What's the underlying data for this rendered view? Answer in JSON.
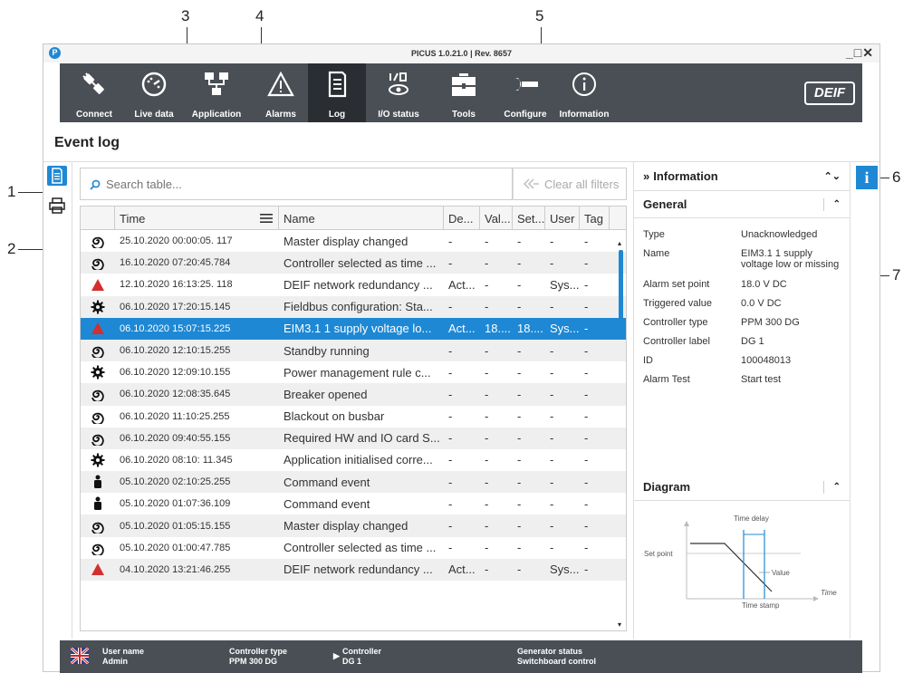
{
  "callouts": [
    "1",
    "2",
    "3",
    "4",
    "5",
    "6",
    "7"
  ],
  "window": {
    "title": "PICUS 1.0.21.0 | Rev. 8657",
    "controls": "_□✕",
    "logo": "P"
  },
  "toolbar": {
    "items": [
      {
        "label": "Connect",
        "icon": "plug-icon"
      },
      {
        "label": "Live data",
        "icon": "gauge-icon"
      },
      {
        "label": "Application",
        "icon": "diagram-icon"
      },
      {
        "label": "Alarms",
        "icon": "warning-icon"
      },
      {
        "label": "Log",
        "icon": "document-icon",
        "active": true
      },
      {
        "label": "I/O status",
        "icon": "io-icon"
      },
      {
        "label": "Tools",
        "icon": "toolbox-icon"
      },
      {
        "label": "Configure",
        "icon": "wrench-icon"
      },
      {
        "label": "Information",
        "icon": "info-icon"
      }
    ],
    "brand": "DEIF"
  },
  "page": {
    "title": "Event log"
  },
  "search": {
    "placeholder": "Search table...",
    "clear_label": "Clear all filters"
  },
  "table": {
    "headers": [
      "Time",
      "Name",
      "De...",
      "Val...",
      "Set...",
      "User",
      "Tag"
    ],
    "rows": [
      {
        "icon": "spiral",
        "time": "25.10.2020 00:00:05. 117",
        "name": "Master display changed",
        "de": "-",
        "val": "-",
        "set": "-",
        "user": "-",
        "tag": "-"
      },
      {
        "icon": "spiral",
        "time": "16.10.2020 07:20:45.784",
        "name": "Controller selected as time ...",
        "de": "-",
        "val": "-",
        "set": "-",
        "user": "-",
        "tag": "-"
      },
      {
        "icon": "alarm",
        "time": "12.10.2020 16:13:25. 118",
        "name": "DEIF network redundancy ...",
        "de": "Act...",
        "val": "-",
        "set": "-",
        "user": "Sys...",
        "tag": "-"
      },
      {
        "icon": "gear",
        "time": "06.10.2020 17:20:15.145",
        "name": "Fieldbus configuration: Sta...",
        "de": "-",
        "val": "-",
        "set": "-",
        "user": "-",
        "tag": "-"
      },
      {
        "icon": "alarm",
        "time": "06.10.2020 15:07:15.225",
        "name": "EIM3.1 1 supply voltage lo...",
        "de": "Act...",
        "val": "18....",
        "set": "18....",
        "user": "Sys...",
        "tag": "-",
        "selected": true
      },
      {
        "icon": "spiral",
        "time": "06.10.2020 12:10:15.255",
        "name": "Standby running",
        "de": "-",
        "val": "-",
        "set": "-",
        "user": "-",
        "tag": "-"
      },
      {
        "icon": "gear",
        "time": "06.10.2020 12:09:10.155",
        "name": "Power management rule c...",
        "de": "-",
        "val": "-",
        "set": "-",
        "user": "-",
        "tag": "-"
      },
      {
        "icon": "spiral",
        "time": "06.10.2020 12:08:35.645",
        "name": "Breaker opened",
        "de": "-",
        "val": "-",
        "set": "-",
        "user": "-",
        "tag": "-"
      },
      {
        "icon": "spiral",
        "time": "06.10.2020  11:10:25.255",
        "name": "Blackout on busbar",
        "de": "-",
        "val": "-",
        "set": "-",
        "user": "-",
        "tag": "-"
      },
      {
        "icon": "spiral",
        "time": "06.10.2020 09:40:55.155",
        "name": "Required HW and IO card S...",
        "de": "-",
        "val": "-",
        "set": "-",
        "user": "-",
        "tag": "-"
      },
      {
        "icon": "gear",
        "time": "06.10.2020 08:10: 11.345",
        "name": "Application initialised corre...",
        "de": "-",
        "val": "-",
        "set": "-",
        "user": "-",
        "tag": "-"
      },
      {
        "icon": "user",
        "time": "05.10.2020 02:10:25.255",
        "name": "Command event",
        "de": "-",
        "val": "-",
        "set": "-",
        "user": "-",
        "tag": "-"
      },
      {
        "icon": "user",
        "time": "05.10.2020 01:07:36.109",
        "name": "Command event",
        "de": "-",
        "val": "-",
        "set": "-",
        "user": "-",
        "tag": "-"
      },
      {
        "icon": "spiral",
        "time": "05.10.2020 01:05:15.155",
        "name": "Master display changed",
        "de": "-",
        "val": "-",
        "set": "-",
        "user": "-",
        "tag": "-"
      },
      {
        "icon": "spiral",
        "time": "05.10.2020 01:00:47.785",
        "name": "Controller selected as time ...",
        "de": "-",
        "val": "-",
        "set": "-",
        "user": "-",
        "tag": "-"
      },
      {
        "icon": "alarm",
        "time": "04.10.2020 13:21:46.255",
        "name": "DEIF network redundancy ...",
        "de": "Act...",
        "val": "-",
        "set": "-",
        "user": "Sys...",
        "tag": "-"
      }
    ]
  },
  "info_panel": {
    "title": "Information",
    "general_title": "General",
    "fields": [
      {
        "key": "Type",
        "value": "Unacknowledged"
      },
      {
        "key": "Name",
        "value": "EIM3.1 1 supply voltage low or missing"
      },
      {
        "key": "Alarm set point",
        "value": "18.0 V DC"
      },
      {
        "key": "Triggered value",
        "value": "0.0 V DC"
      },
      {
        "key": "Controller type",
        "value": "PPM 300 DG"
      },
      {
        "key": "Controller label",
        "value": "DG 1"
      },
      {
        "key": "ID",
        "value": "100048013"
      },
      {
        "key": "Alarm Test",
        "value": "Start test"
      }
    ],
    "diagram_title": "Diagram",
    "diagram": {
      "time_delay": "Time delay",
      "set_point": "Set point",
      "value": "Value",
      "time": "Time",
      "time_stamp": "Time stamp"
    }
  },
  "status_bar": {
    "user_name_label": "User name",
    "user_name_value": "Admin",
    "controller_type_label": "Controller type",
    "controller_type_value": "PPM 300 DG",
    "controller_label": "Controller",
    "controller_value": "DG 1",
    "generator_status_label": "Generator status",
    "generator_status_value": "Switchboard control"
  },
  "colors": {
    "accent": "#1e88d4",
    "toolbar": "#4a4f55",
    "alarm": "#d32f2f"
  }
}
